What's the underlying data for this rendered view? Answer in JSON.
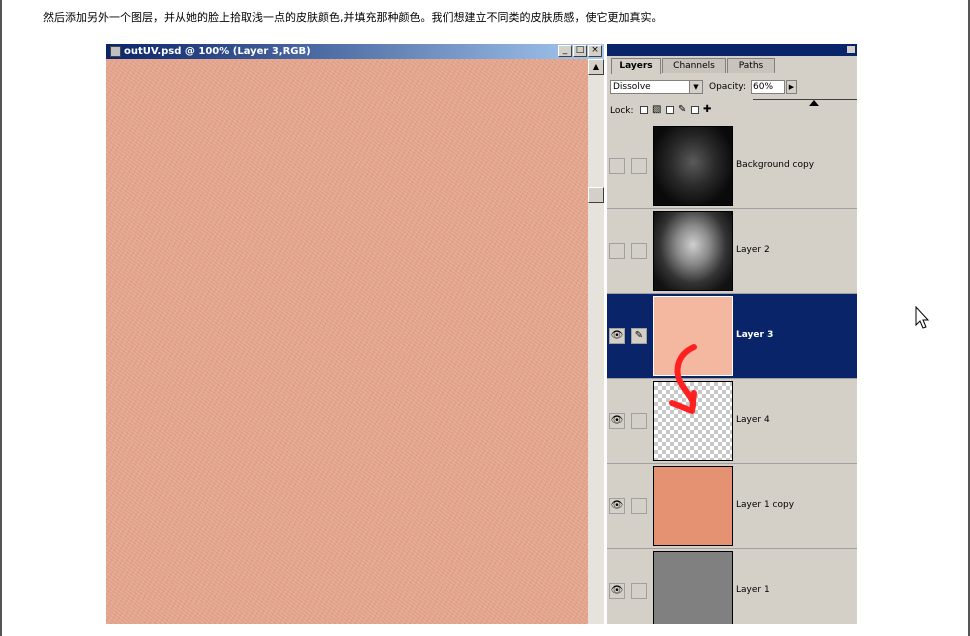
{
  "intro_text": "然后添加另外一个图层，并从她的脸上拾取浅一点的皮肤颜色,并填充那种颜色。我们想建立不同类的皮肤质感，使它更加真实。",
  "document_window": {
    "title": "outUV.psd @ 100% (Layer 3,RGB)",
    "buttons": [
      "_",
      "□",
      "×"
    ]
  },
  "palette": {
    "tabs": [
      {
        "label": "Layers",
        "active": true
      },
      {
        "label": "Channels",
        "active": false
      },
      {
        "label": "Paths",
        "active": false
      }
    ],
    "blend_mode": "Dissolve",
    "opacity_label": "Opacity:",
    "opacity_value": "60%",
    "lock_label": "Lock:",
    "layers": [
      {
        "name": "Background copy",
        "visible": false,
        "selected": false,
        "thumb": "dark-face",
        "brush": false
      },
      {
        "name": "Layer 2",
        "visible": false,
        "selected": false,
        "thumb": "face",
        "brush": false
      },
      {
        "name": "Layer 3",
        "visible": true,
        "selected": true,
        "thumb": "#f4b7a0",
        "brush": true
      },
      {
        "name": "Layer 4",
        "visible": true,
        "selected": false,
        "thumb": "transparent",
        "brush": false
      },
      {
        "name": "Layer 1 copy",
        "visible": true,
        "selected": false,
        "thumb": "#e49271",
        "brush": false
      },
      {
        "name": "Layer 1",
        "visible": true,
        "selected": false,
        "thumb": "#808080",
        "brush": false
      }
    ]
  },
  "colors": {
    "canvas_skin": "#e8a992",
    "selection_highlight": "#0a246a",
    "annotation_arrow": "#ff2020"
  }
}
